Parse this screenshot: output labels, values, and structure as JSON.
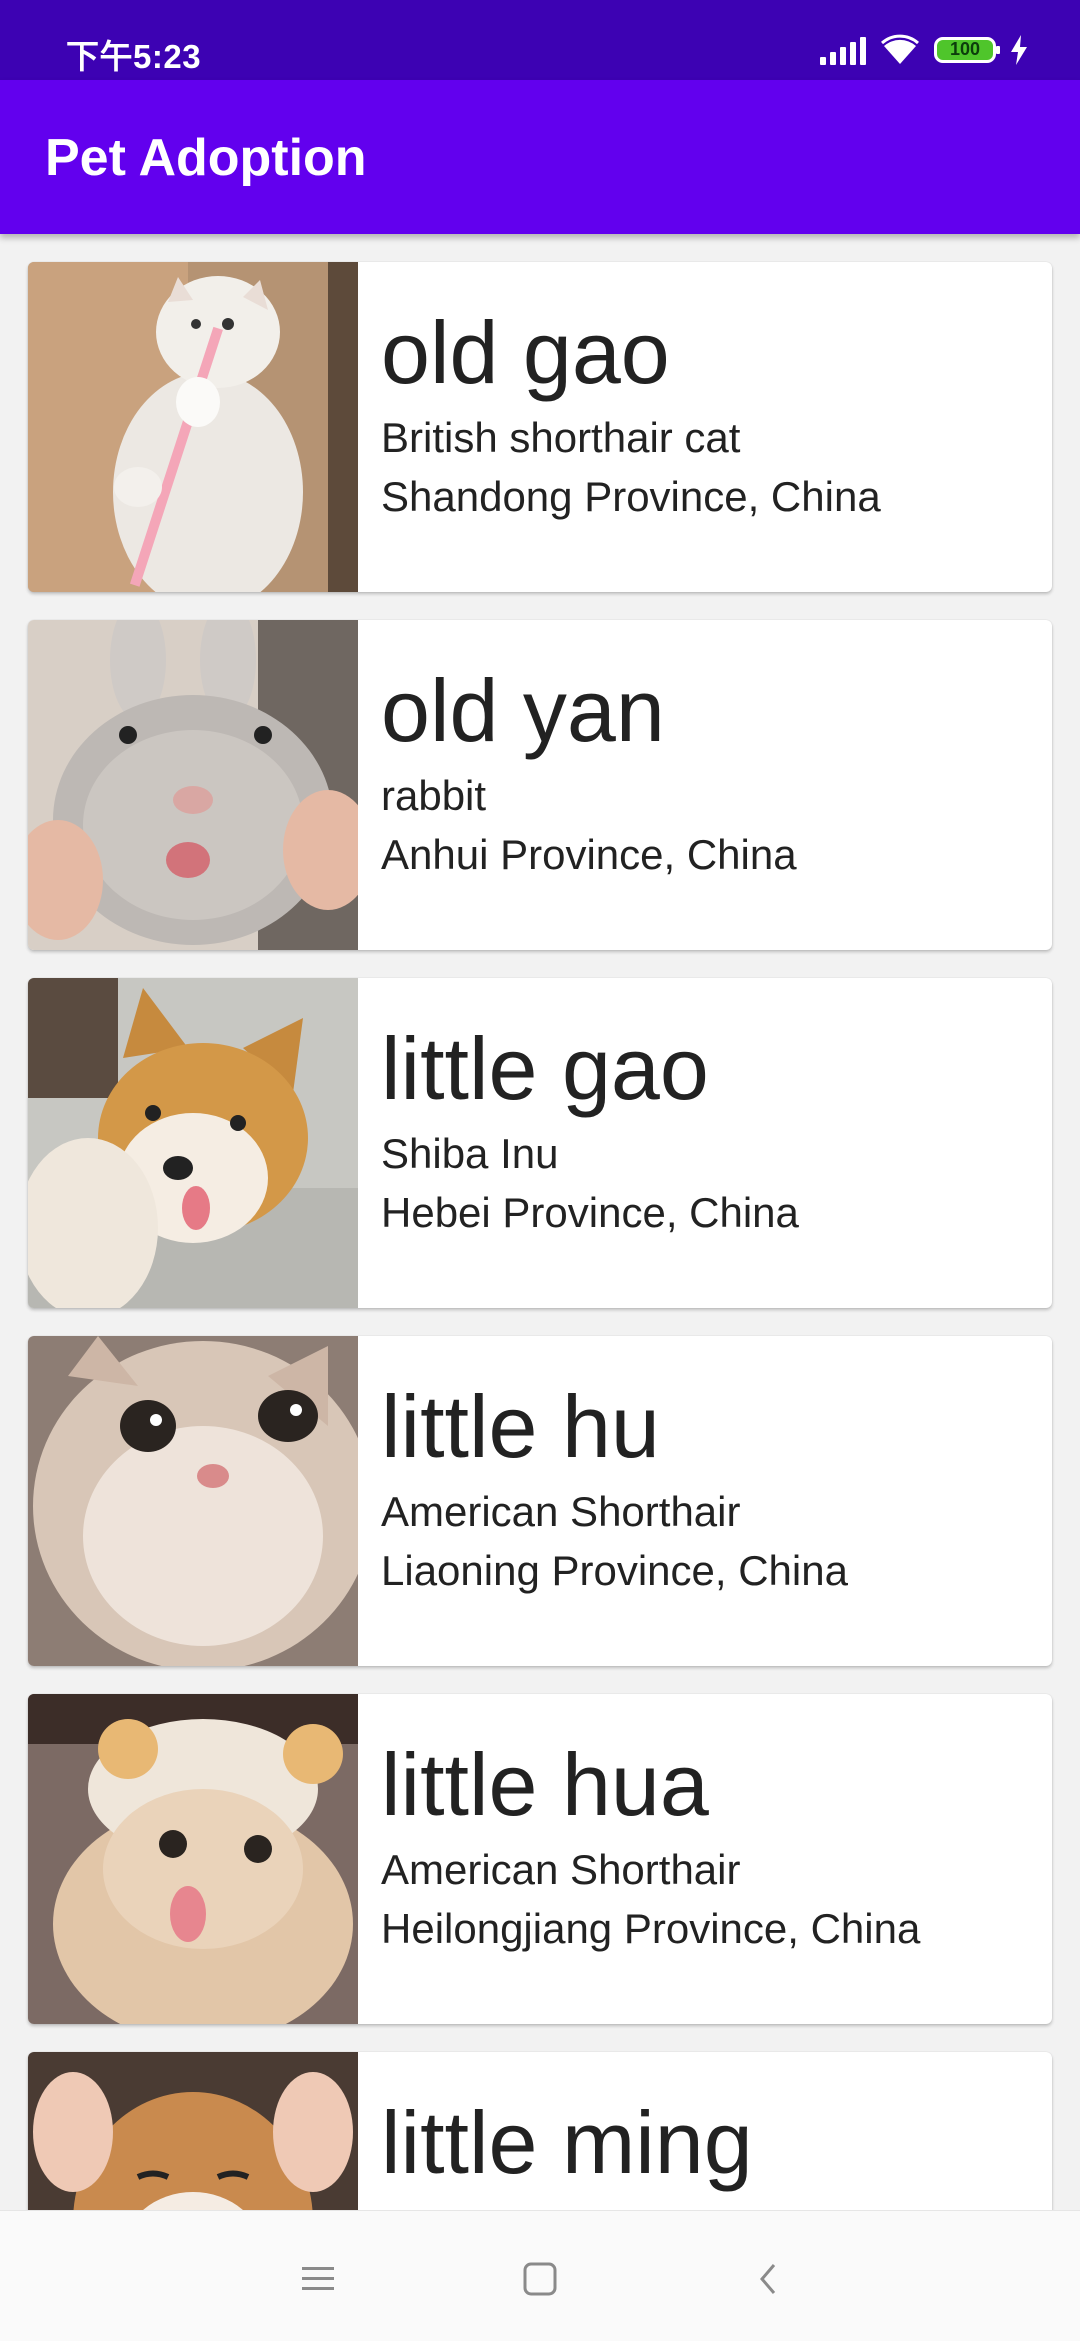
{
  "status_bar": {
    "time": "下午5:23",
    "battery": "100",
    "icons": [
      "signal-icon",
      "wifi-icon",
      "battery-icon",
      "charging-bolt-icon"
    ]
  },
  "app_bar": {
    "title": "Pet Adoption",
    "color": "#6200ee"
  },
  "pets": [
    {
      "name": "old gao",
      "breed": "British shorthair cat",
      "location": "Shandong Province, China"
    },
    {
      "name": "old yan",
      "breed": "rabbit",
      "location": "Anhui Province, China"
    },
    {
      "name": "little gao",
      "breed": "Shiba Inu",
      "location": "Hebei Province, China"
    },
    {
      "name": "little hu",
      "breed": "American Shorthair",
      "location": "Liaoning Province, China"
    },
    {
      "name": "little hua",
      "breed": "American Shorthair",
      "location": "Heilongjiang Province, China"
    },
    {
      "name": "little ming",
      "breed": "",
      "location": ""
    }
  ],
  "nav_bar": {
    "icons": [
      "menu-icon",
      "home-icon",
      "back-icon"
    ]
  }
}
